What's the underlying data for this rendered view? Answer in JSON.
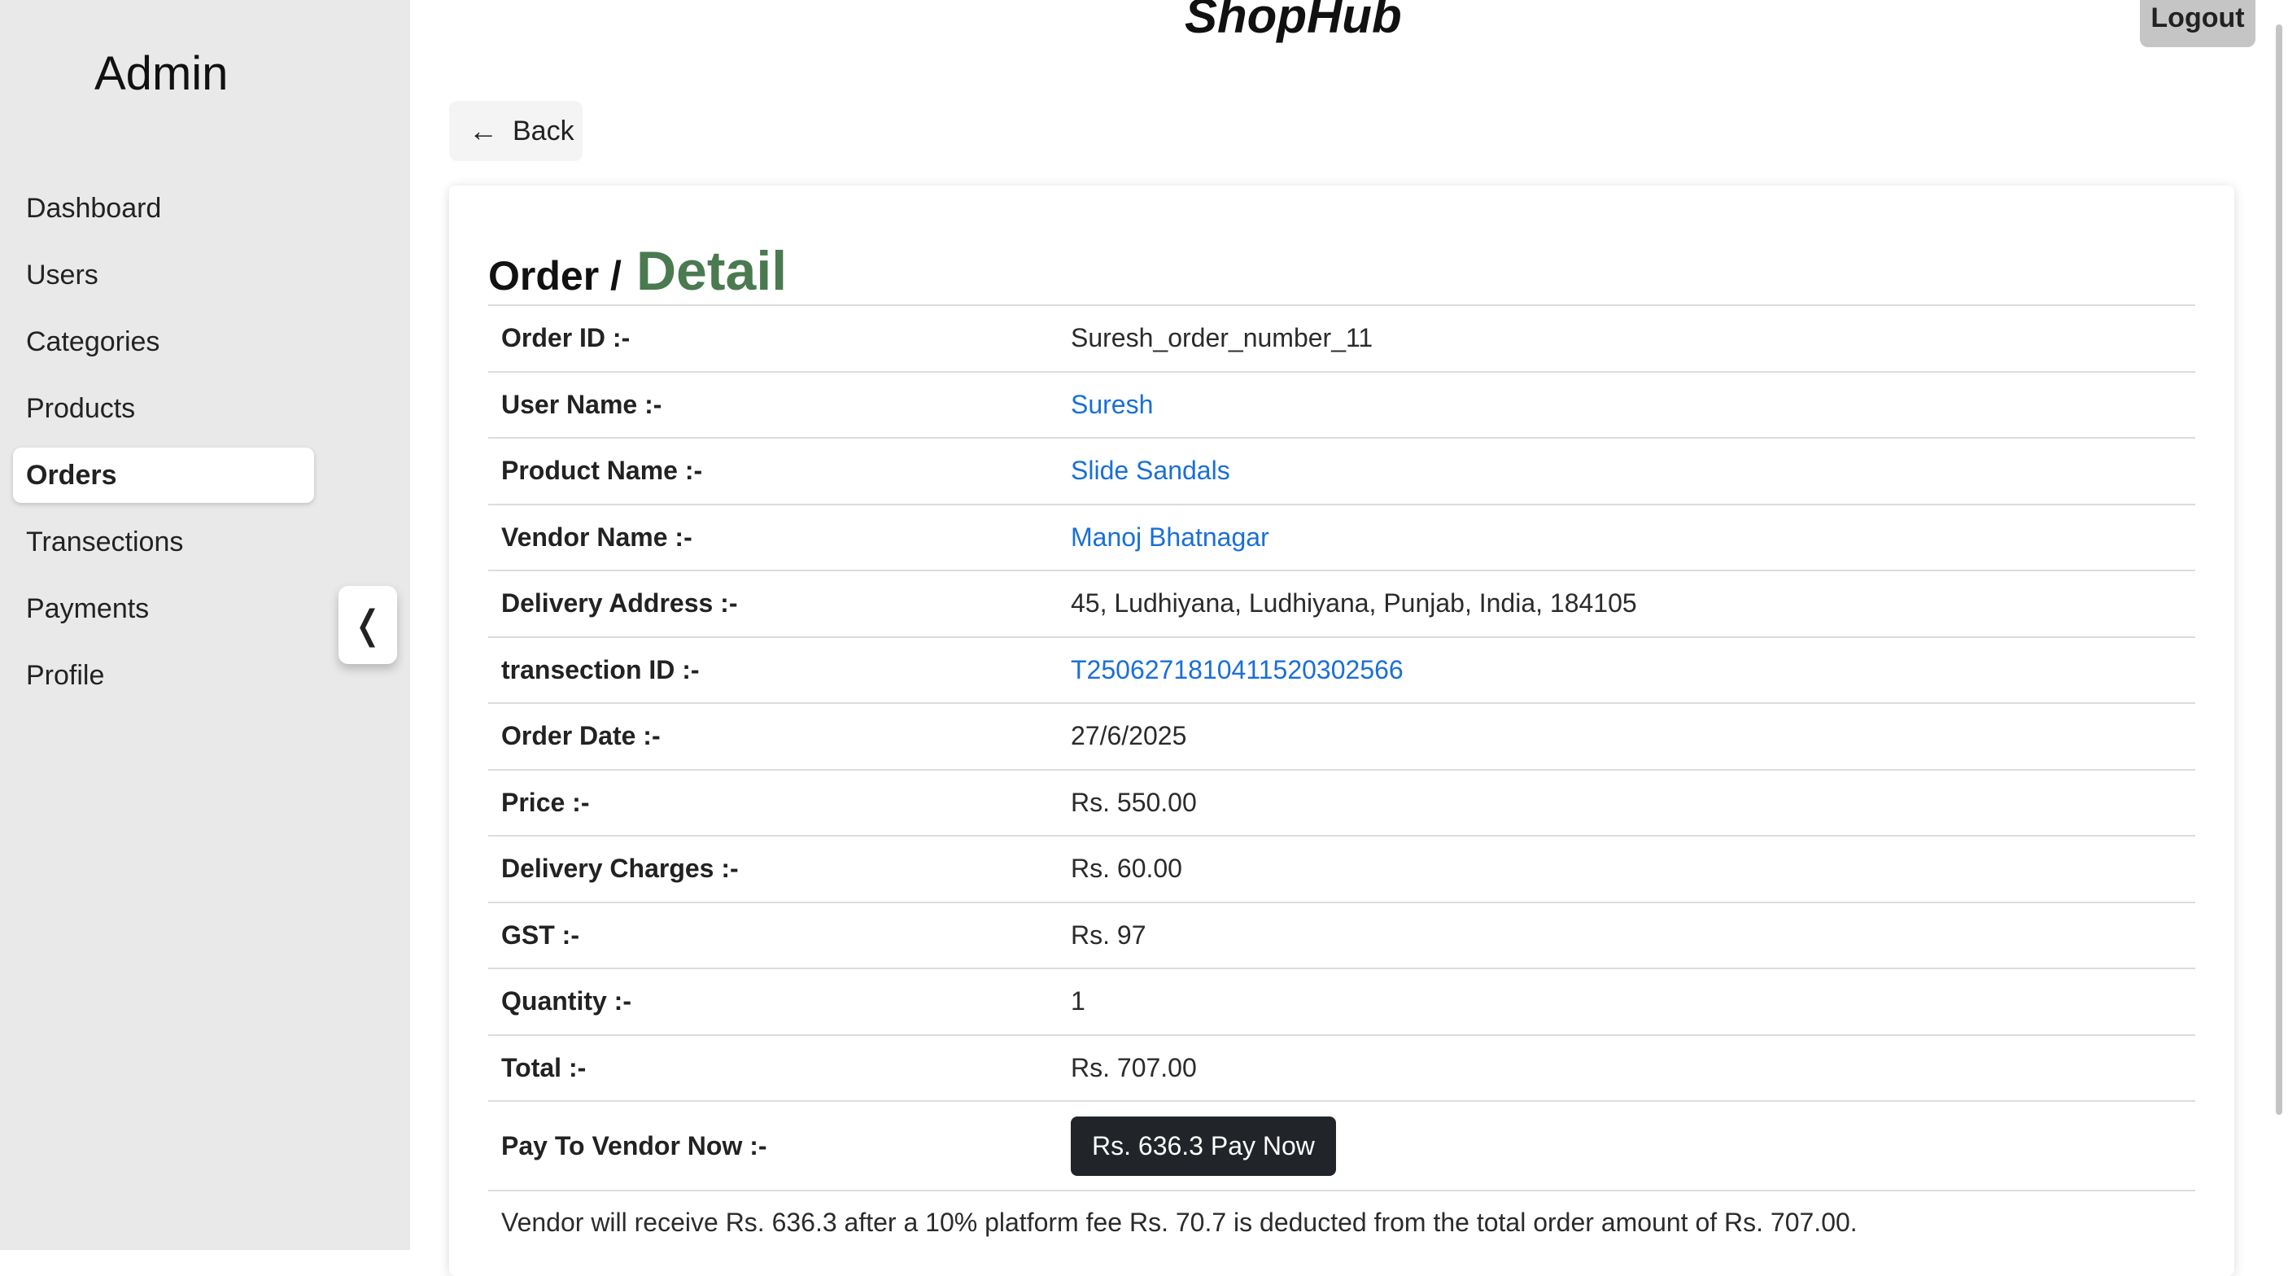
{
  "sidebar": {
    "brand": "Admin",
    "items": [
      {
        "label": "Dashboard",
        "active": false
      },
      {
        "label": "Users",
        "active": false
      },
      {
        "label": "Categories",
        "active": false
      },
      {
        "label": "Products",
        "active": false
      },
      {
        "label": "Orders",
        "active": true
      },
      {
        "label": "Transections",
        "active": false
      },
      {
        "label": "Payments",
        "active": false
      },
      {
        "label": "Profile",
        "active": false
      }
    ],
    "collapse_icon": "❬"
  },
  "header": {
    "app_title": "ShopHub",
    "logout_label": "Logout"
  },
  "back": {
    "icon": "←",
    "label": "Back"
  },
  "card": {
    "title_main": "Order /",
    "title_sub": "Detail",
    "rows": [
      {
        "label": "Order ID :-",
        "value": "Suresh_order_number_11",
        "link": false
      },
      {
        "label": "User Name :-",
        "value": "Suresh",
        "link": true
      },
      {
        "label": "Product Name :-",
        "value": "Slide Sandals",
        "link": true
      },
      {
        "label": "Vendor Name :-",
        "value": "Manoj Bhatnagar",
        "link": true
      },
      {
        "label": "Delivery Address :-",
        "value": "45, Ludhiyana, Ludhiyana, Punjab, India, 184105",
        "link": false
      },
      {
        "label": "transection ID :-",
        "value": "T2506271810411520302566",
        "link": true
      },
      {
        "label": "Order Date :-",
        "value": "27/6/2025",
        "link": false
      },
      {
        "label": "Price :-",
        "value": "Rs. 550.00",
        "link": false
      },
      {
        "label": "Delivery Charges :-",
        "value": "Rs. 60.00",
        "link": false
      },
      {
        "label": "GST :-",
        "value": "Rs. 97",
        "link": false
      },
      {
        "label": "Quantity :-",
        "value": "1",
        "link": false
      },
      {
        "label": "Total :-",
        "value": "Rs. 707.00",
        "link": false
      }
    ],
    "pay_label": "Pay To Vendor Now :-",
    "pay_button": "Rs. 636.3 Pay Now",
    "note": "Vendor will receive Rs. 636.3 after a 10% platform fee Rs. 70.7 is deducted from the total order amount of Rs. 707.00."
  },
  "colors": {
    "sidebar_bg": "#e9e9e9",
    "link": "#1a6fd6",
    "title_accent": "#4a7a50",
    "pay_button_bg": "#212529"
  }
}
